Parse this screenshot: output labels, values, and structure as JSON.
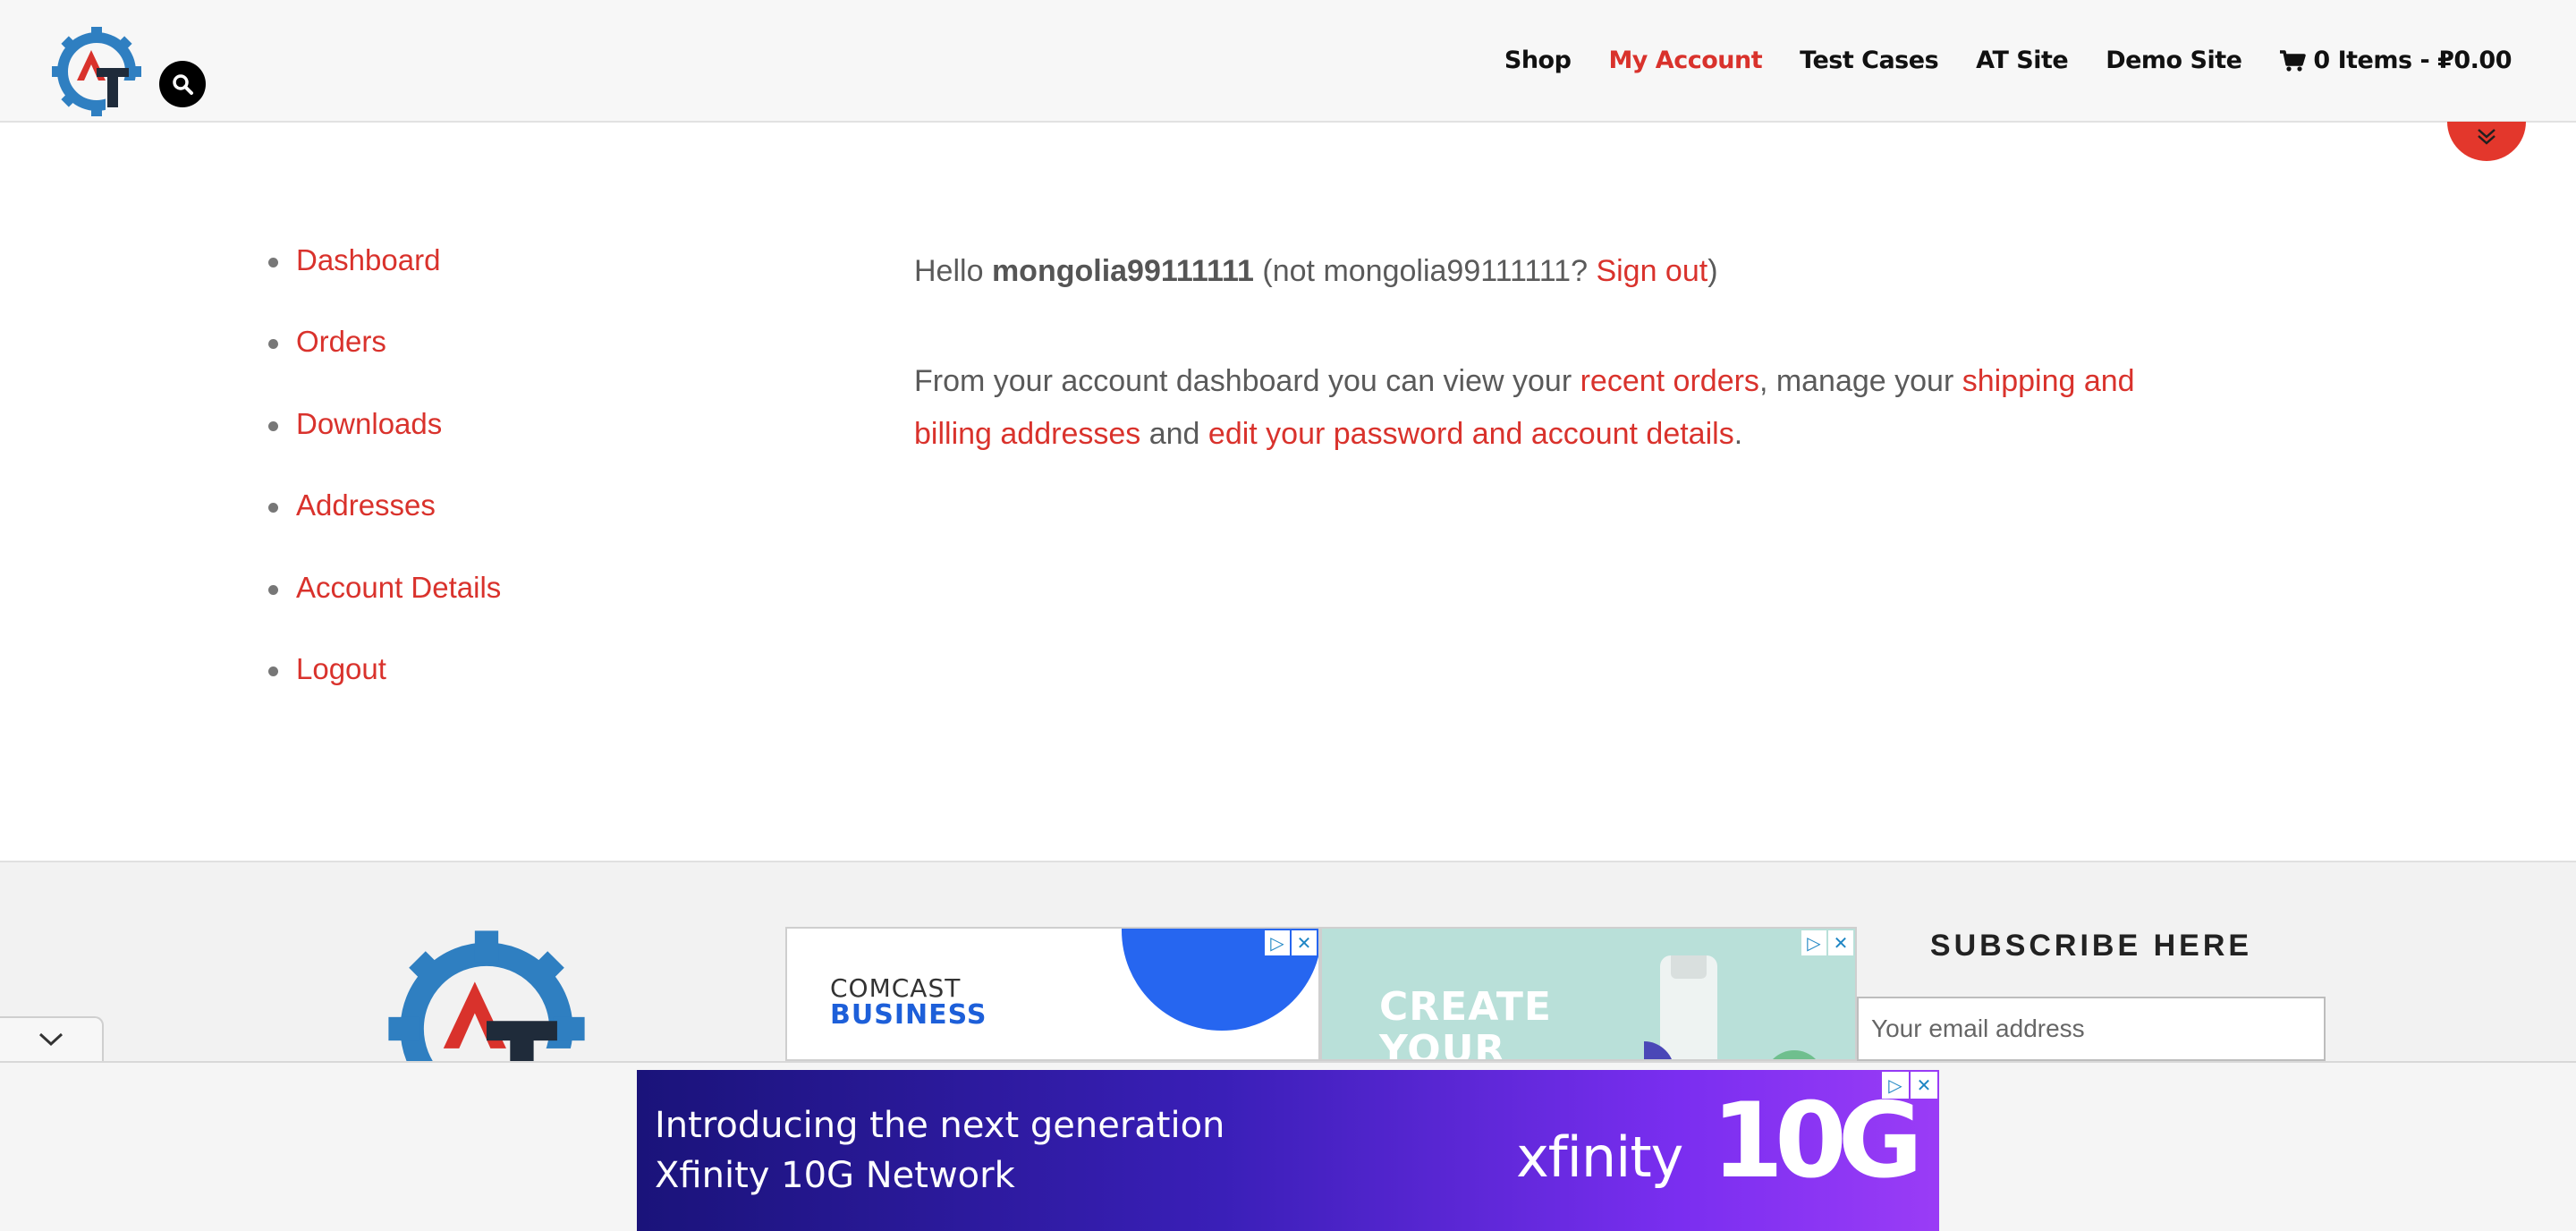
{
  "header": {
    "nav": {
      "shop": "Shop",
      "my_account": "My Account",
      "test_cases": "Test Cases",
      "at_site": "AT Site",
      "demo_site": "Demo Site",
      "cart": "0 Items - ₽0.00"
    },
    "accent_color": "#d9322c"
  },
  "account_nav": [
    {
      "label": "Dashboard"
    },
    {
      "label": "Orders"
    },
    {
      "label": "Downloads"
    },
    {
      "label": "Addresses"
    },
    {
      "label": "Account Details"
    },
    {
      "label": "Logout"
    }
  ],
  "dashboard": {
    "hello": "Hello",
    "username": "mongolia99111111",
    "not_prefix": "(not mongolia99111111?",
    "sign_out": "Sign out",
    "close_paren": ")",
    "intro": "From your account dashboard you can view your",
    "recent_orders": "recent orders",
    "manage": ", manage your",
    "addresses_link": "shipping and billing addresses",
    "and": "and",
    "edit_link": "edit your password and account details",
    "period": "."
  },
  "footer": {
    "ad1": {
      "line1": "COMCAST",
      "line2": "BUSINESS"
    },
    "ad2": {
      "line1": "CREATE",
      "line2": "YOUR"
    },
    "subscribe_title": "SUBSCRIBE HERE",
    "email_placeholder": "Your email address"
  },
  "anchor_ad": {
    "line1": "Introducing the next generation",
    "line2": "Xfinity 10G Network",
    "brand": "xfinity",
    "brand_mark": "10G"
  }
}
